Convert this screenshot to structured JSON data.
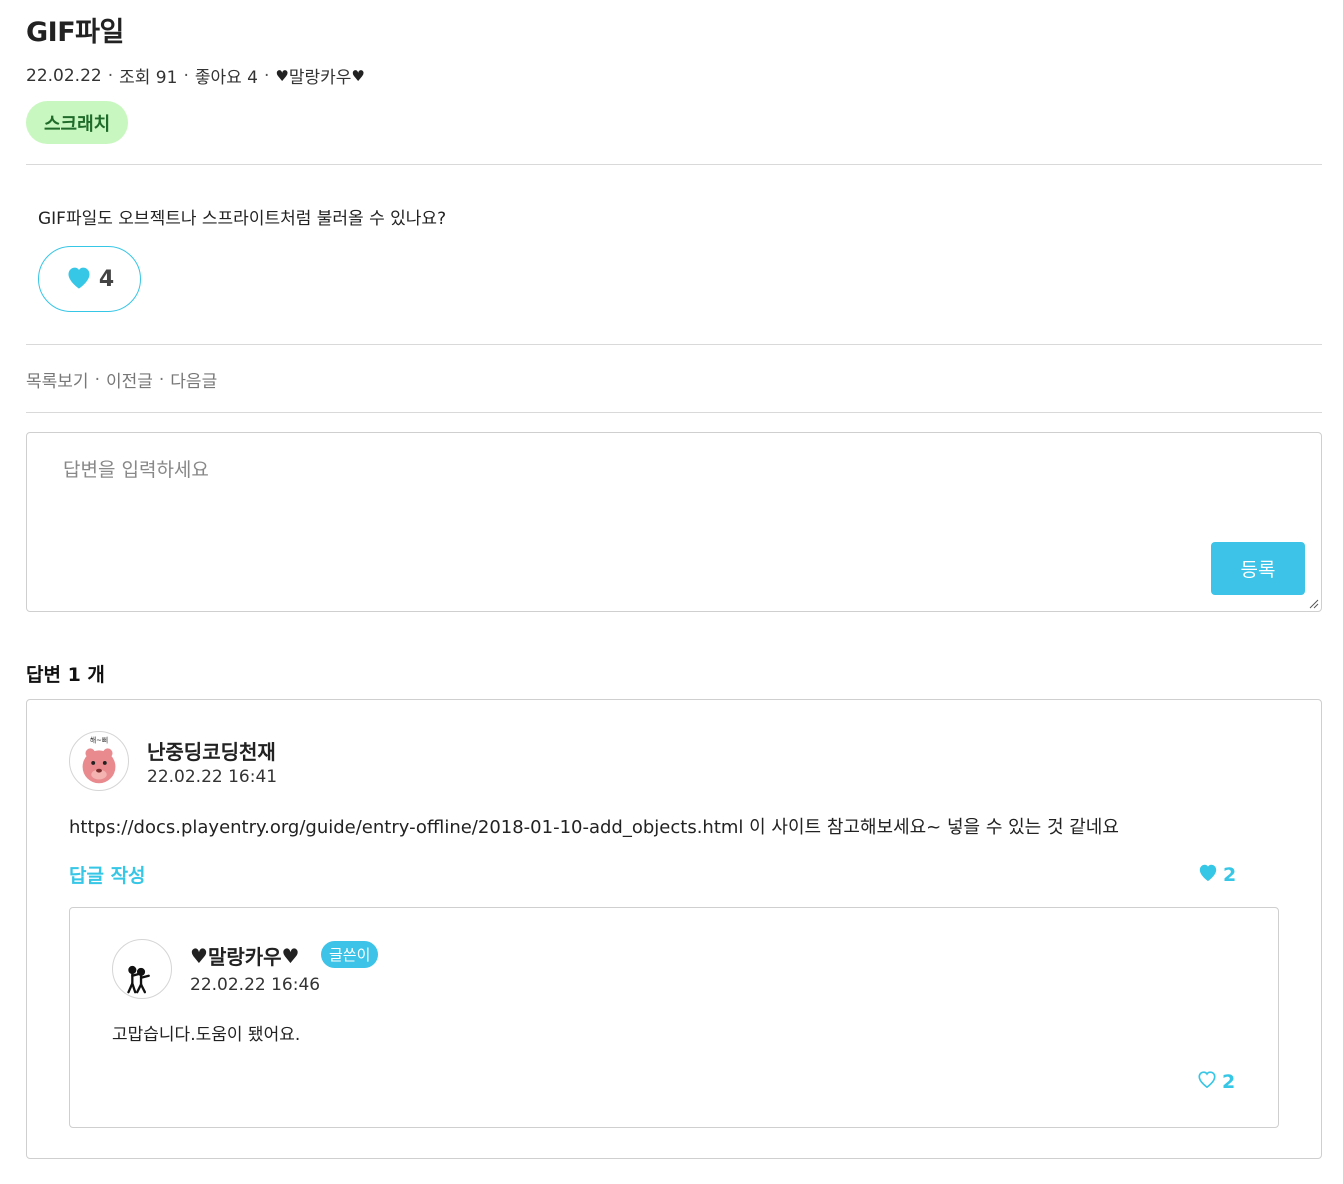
{
  "post": {
    "title": "GIF파일",
    "date": "22.02.22",
    "views": "조회 91",
    "likes": "좋아요 4",
    "author": "말랑카우",
    "category": "스크래치",
    "body": "GIF파일도 오브젝트나 스프라이트처럼 불러올 수 있나요?",
    "like_count": "4"
  },
  "nav": {
    "list": "목록보기",
    "prev": "이전글",
    "next": "다음글"
  },
  "answer_form": {
    "placeholder": "답변을 입력하세요",
    "submit": "등록"
  },
  "answers_header": "답변 1 개",
  "answers": [
    {
      "author": "난중딩코딩천재",
      "date": "22.02.22 16:41",
      "text": "https://docs.playentry.org/guide/entry-offline/2018-01-10-add_objects.html 이 사이트 참고해보세요~ 넣을 수 있는 것 같네요",
      "reply_label": "답글 작성",
      "like_count": "2",
      "avatar_caption": "해~삐",
      "replies": [
        {
          "author": "말랑카우",
          "badge": "글쓴이",
          "date": "22.02.22 16:46",
          "text": "고맙습니다.도움이 됐어요.",
          "like_count": "2"
        }
      ]
    }
  ],
  "colors": {
    "accent": "#36c6e6",
    "tag_bg": "#c9f7c0",
    "tag_text": "#1f6b2a",
    "border": "#cfcfcf"
  },
  "icons": {
    "heart_filled": "heart-filled-icon",
    "heart_outline": "heart-outline-icon",
    "black_heart": "black-heart-icon"
  }
}
